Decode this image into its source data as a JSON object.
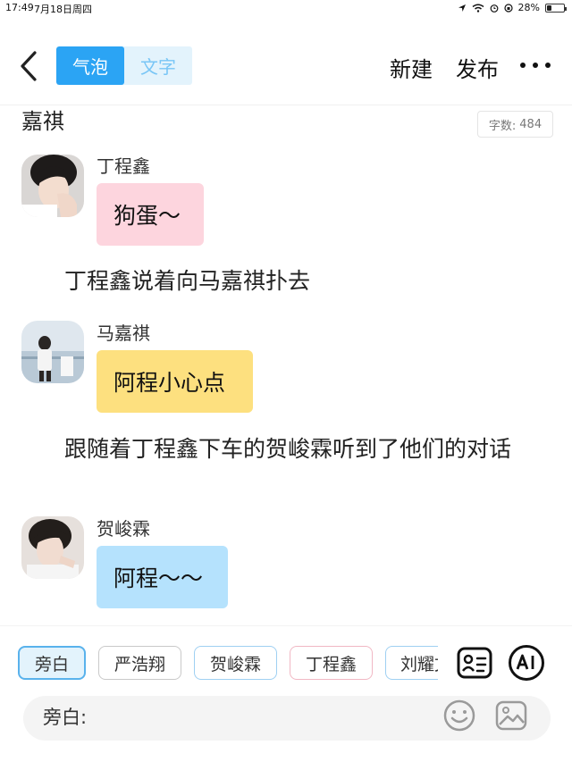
{
  "status_bar": {
    "time": "17:49",
    "date": "7月18日周四",
    "battery": "28%",
    "battery_level": 0.28
  },
  "nav": {
    "mode_tabs": [
      {
        "label": "气泡",
        "active": true
      },
      {
        "label": "文字",
        "active": false
      }
    ],
    "new_label": "新建",
    "publish_label": "发布"
  },
  "story": {
    "partial_top_text": "嘉祺",
    "word_count_label": "字数:",
    "word_count_value": "484",
    "messages": [
      {
        "speaker": "丁程鑫",
        "text": "狗蛋～",
        "bubble_color": "#fdd5de"
      },
      {
        "speaker": "马嘉祺",
        "text": "阿程小心点",
        "bubble_color": "#fde07f"
      },
      {
        "speaker": "贺峻霖",
        "text": "阿程～～",
        "bubble_color": "#b5e2fd"
      }
    ],
    "narrations": [
      "丁程鑫说着向马嘉祺扑去",
      "跟随着丁程鑫下车的贺峻霖听到了他们的对话"
    ]
  },
  "roles": {
    "chips": [
      {
        "label": "旁白",
        "selected": true
      },
      {
        "label": "严浩翔",
        "selected": false
      },
      {
        "label": "贺峻霖",
        "selected": false
      },
      {
        "label": "丁程鑫",
        "selected": false
      },
      {
        "label": "刘耀文",
        "selected": false
      }
    ]
  },
  "composer": {
    "label": "旁白:"
  },
  "icons": {
    "back": "chevron-left-icon",
    "more": "more-dots-icon",
    "role_card": "role-card-icon",
    "ai": "ai-icon",
    "emoji": "emoji-icon",
    "image": "image-icon"
  },
  "colors": {
    "accent": "#2ba4f4",
    "toggle_bg": "#e3f3fc"
  }
}
